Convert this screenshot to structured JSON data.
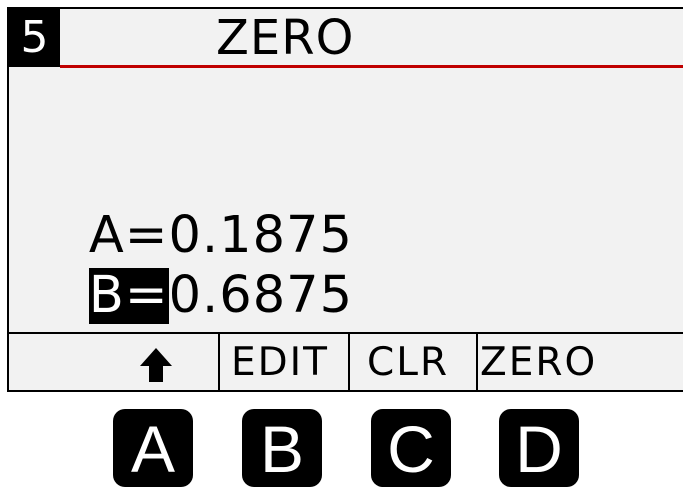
{
  "header": {
    "page_number": "5",
    "title": "ZERO"
  },
  "readings": [
    {
      "label": "A=",
      "value": "0.1875",
      "selected": false
    },
    {
      "label": "B=",
      "value": "0.6875",
      "selected": true
    }
  ],
  "softkeys": [
    {
      "label": "",
      "icon": "up-arrow-icon"
    },
    {
      "label": "EDIT"
    },
    {
      "label": "CLR"
    },
    {
      "label": "ZERO"
    }
  ],
  "hardware_keys": [
    "A",
    "B",
    "C",
    "D"
  ],
  "colors": {
    "screen_background": "#f2f2f2",
    "title_rule": "#c00000",
    "text": "#000000",
    "highlight_background": "#000000",
    "highlight_text": "#ffffff"
  }
}
